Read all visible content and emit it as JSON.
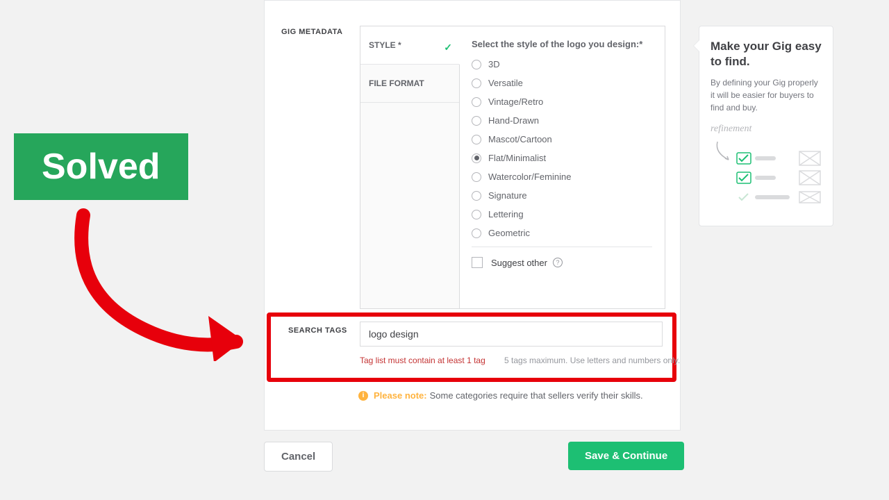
{
  "metadata": {
    "section_label": "GIG METADATA",
    "tabs": {
      "style": "STYLE *",
      "file_format": "FILE FORMAT"
    },
    "style_heading": "Select the style of the logo you design:*",
    "styles": [
      "3D",
      "Versatile",
      "Vintage/Retro",
      "Hand-Drawn",
      "Mascot/Cartoon",
      "Flat/Minimalist",
      "Watercolor/Feminine",
      "Signature",
      "Lettering",
      "Geometric"
    ],
    "selected_style": "Flat/Minimalist",
    "suggest_other": "Suggest other"
  },
  "search_tags": {
    "section_label": "SEARCH TAGS",
    "input_value": "logo design",
    "error": "Tag list must contain at least 1 tag",
    "hint": "5 tags maximum. Use letters and numbers only."
  },
  "note": {
    "bold": "Please note:",
    "text": "Some categories require that sellers verify their skills."
  },
  "buttons": {
    "cancel": "Cancel",
    "save": "Save & Continue"
  },
  "tip": {
    "title": "Make your Gig easy to find.",
    "text": "By defining your Gig properly it will be easier for buyers to find and buy.",
    "hand": "refinement"
  },
  "overlay": {
    "solved": "Solved"
  }
}
